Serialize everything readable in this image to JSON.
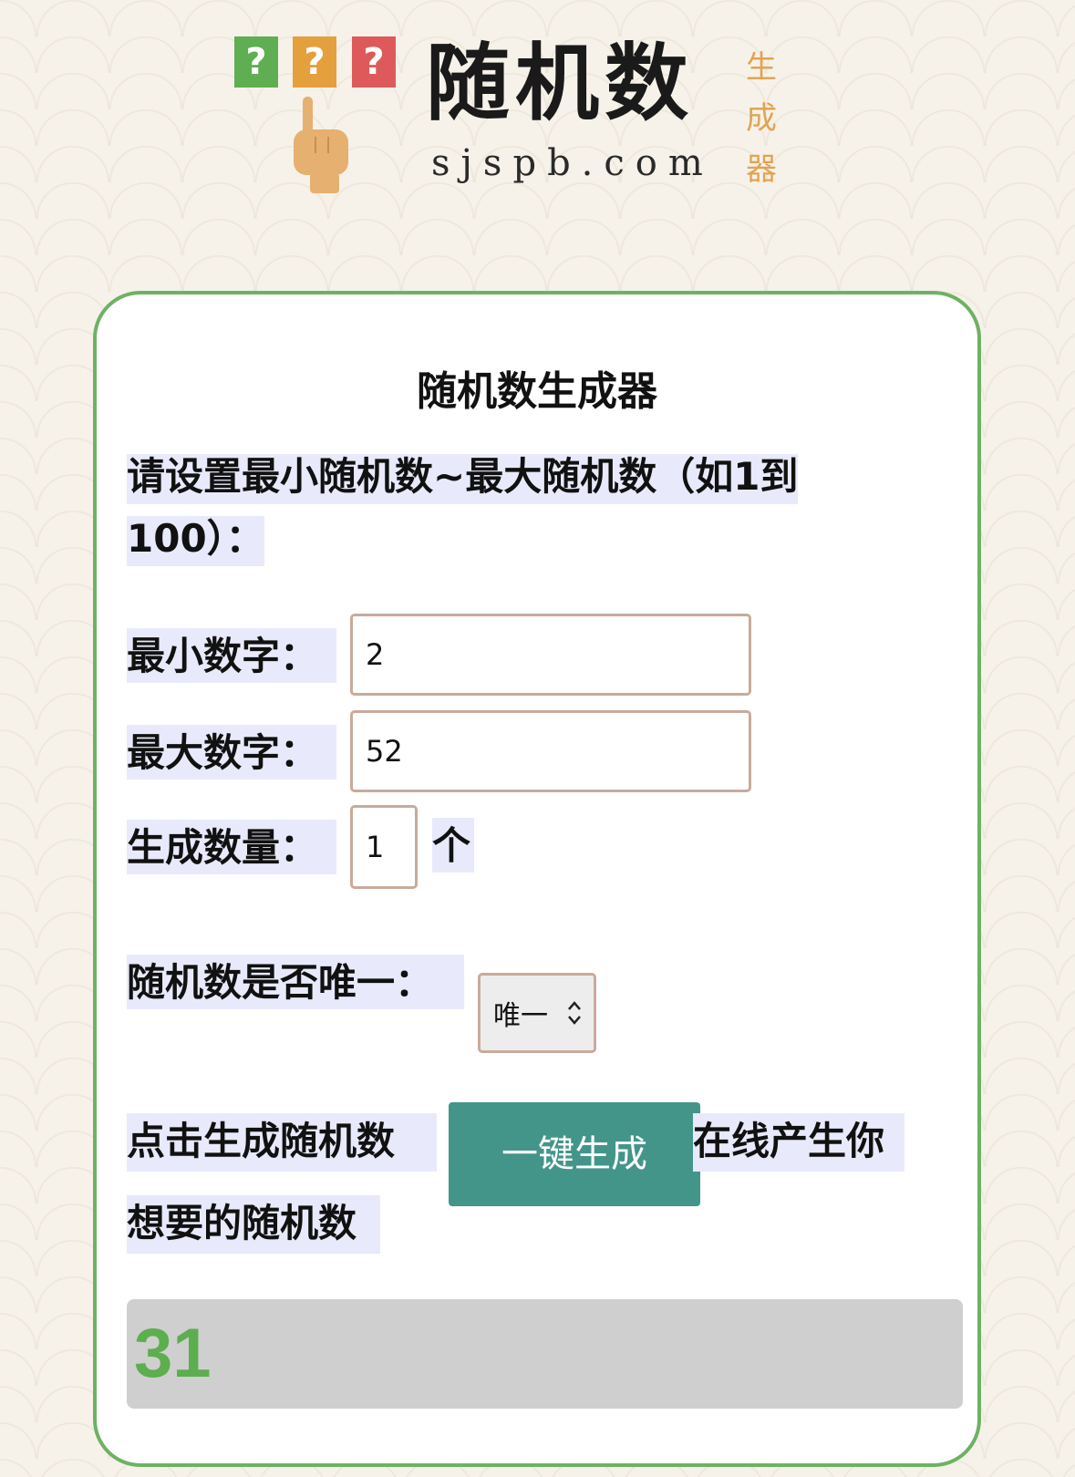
{
  "logo": {
    "question_mark": "?",
    "title": "随机数",
    "domain": "sjspb.com",
    "side_text": [
      "生",
      "成",
      "器"
    ]
  },
  "card": {
    "title": "随机数生成器",
    "intro_line1": "请设置最小随机数~最大随机数（如1到",
    "intro_line2": "100）：",
    "min_label": "最小数字：",
    "min_value": "2",
    "max_label": "最大数字：",
    "max_value": "52",
    "count_label": "生成数量：",
    "count_value": "1",
    "count_unit": "个",
    "unique_label": "随机数是否唯一：",
    "unique_selected": "唯一",
    "action_prefix": "点击生成随机数",
    "generate_button": "一键生成",
    "action_suffix_1": "在线产生你",
    "action_suffix_2": "想要的随机数",
    "result": "31"
  },
  "colors": {
    "card_border": "#6db263",
    "button": "#43958a",
    "result_text": "#5cae4f",
    "result_bg": "#cfcfcf",
    "label_highlight": "#e8eafb",
    "input_border": "#c8ab9b"
  }
}
